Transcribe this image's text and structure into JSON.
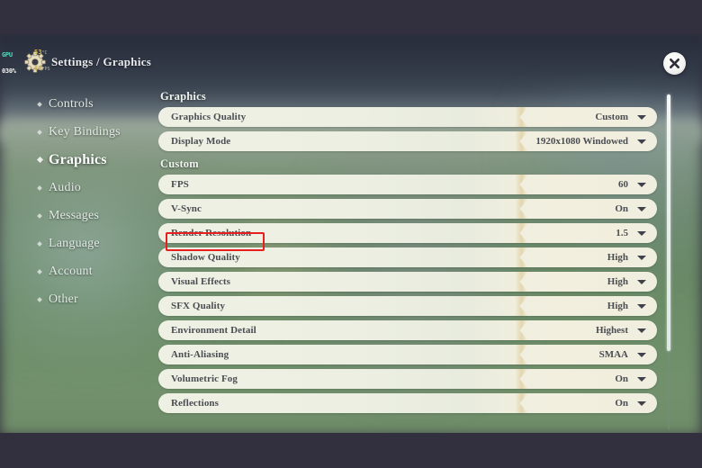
{
  "overlay": {
    "gpu_label": "GPU",
    "gpu_usage": "030%",
    "temp_value": "53",
    "temp_unit": "°C",
    "fps_value": "60",
    "fps_unit": "FPS"
  },
  "header": {
    "title": "Settings / Graphics",
    "gear_icon": "gear-icon",
    "close_icon": "close-icon"
  },
  "sidebar": {
    "items": [
      {
        "label": "Controls",
        "active": false
      },
      {
        "label": "Key Bindings",
        "active": false
      },
      {
        "label": "Graphics",
        "active": true
      },
      {
        "label": "Audio",
        "active": false
      },
      {
        "label": "Messages",
        "active": false
      },
      {
        "label": "Language",
        "active": false
      },
      {
        "label": "Account",
        "active": false
      },
      {
        "label": "Other",
        "active": false
      }
    ]
  },
  "panel": {
    "groups": [
      {
        "title": "Graphics",
        "rows": [
          {
            "label": "Graphics Quality",
            "value": "Custom",
            "highlighted": false
          },
          {
            "label": "Display Mode",
            "value": "1920x1080 Windowed",
            "highlighted": false
          }
        ]
      },
      {
        "title": "Custom",
        "rows": [
          {
            "label": "FPS",
            "value": "60",
            "highlighted": false
          },
          {
            "label": "V-Sync",
            "value": "On",
            "highlighted": false
          },
          {
            "label": "Render Resolution",
            "value": "1.5",
            "highlighted": true
          },
          {
            "label": "Shadow Quality",
            "value": "High",
            "highlighted": false
          },
          {
            "label": "Visual Effects",
            "value": "High",
            "highlighted": false
          },
          {
            "label": "SFX Quality",
            "value": "High",
            "highlighted": false
          },
          {
            "label": "Environment Detail",
            "value": "Highest",
            "highlighted": false
          },
          {
            "label": "Anti-Aliasing",
            "value": "SMAA",
            "highlighted": false
          },
          {
            "label": "Volumetric Fog",
            "value": "On",
            "highlighted": false
          },
          {
            "label": "Reflections",
            "value": "On",
            "highlighted": false
          }
        ]
      }
    ]
  },
  "annotation": {
    "color": "#e81f1f",
    "target": "Render Resolution"
  },
  "colors": {
    "letterbox": "#32303e",
    "row_bg": "#eef0e4",
    "row_text": "#4a4d52",
    "nav_text": "#e4e9e6",
    "accent_notch": "#e0ce9e"
  }
}
